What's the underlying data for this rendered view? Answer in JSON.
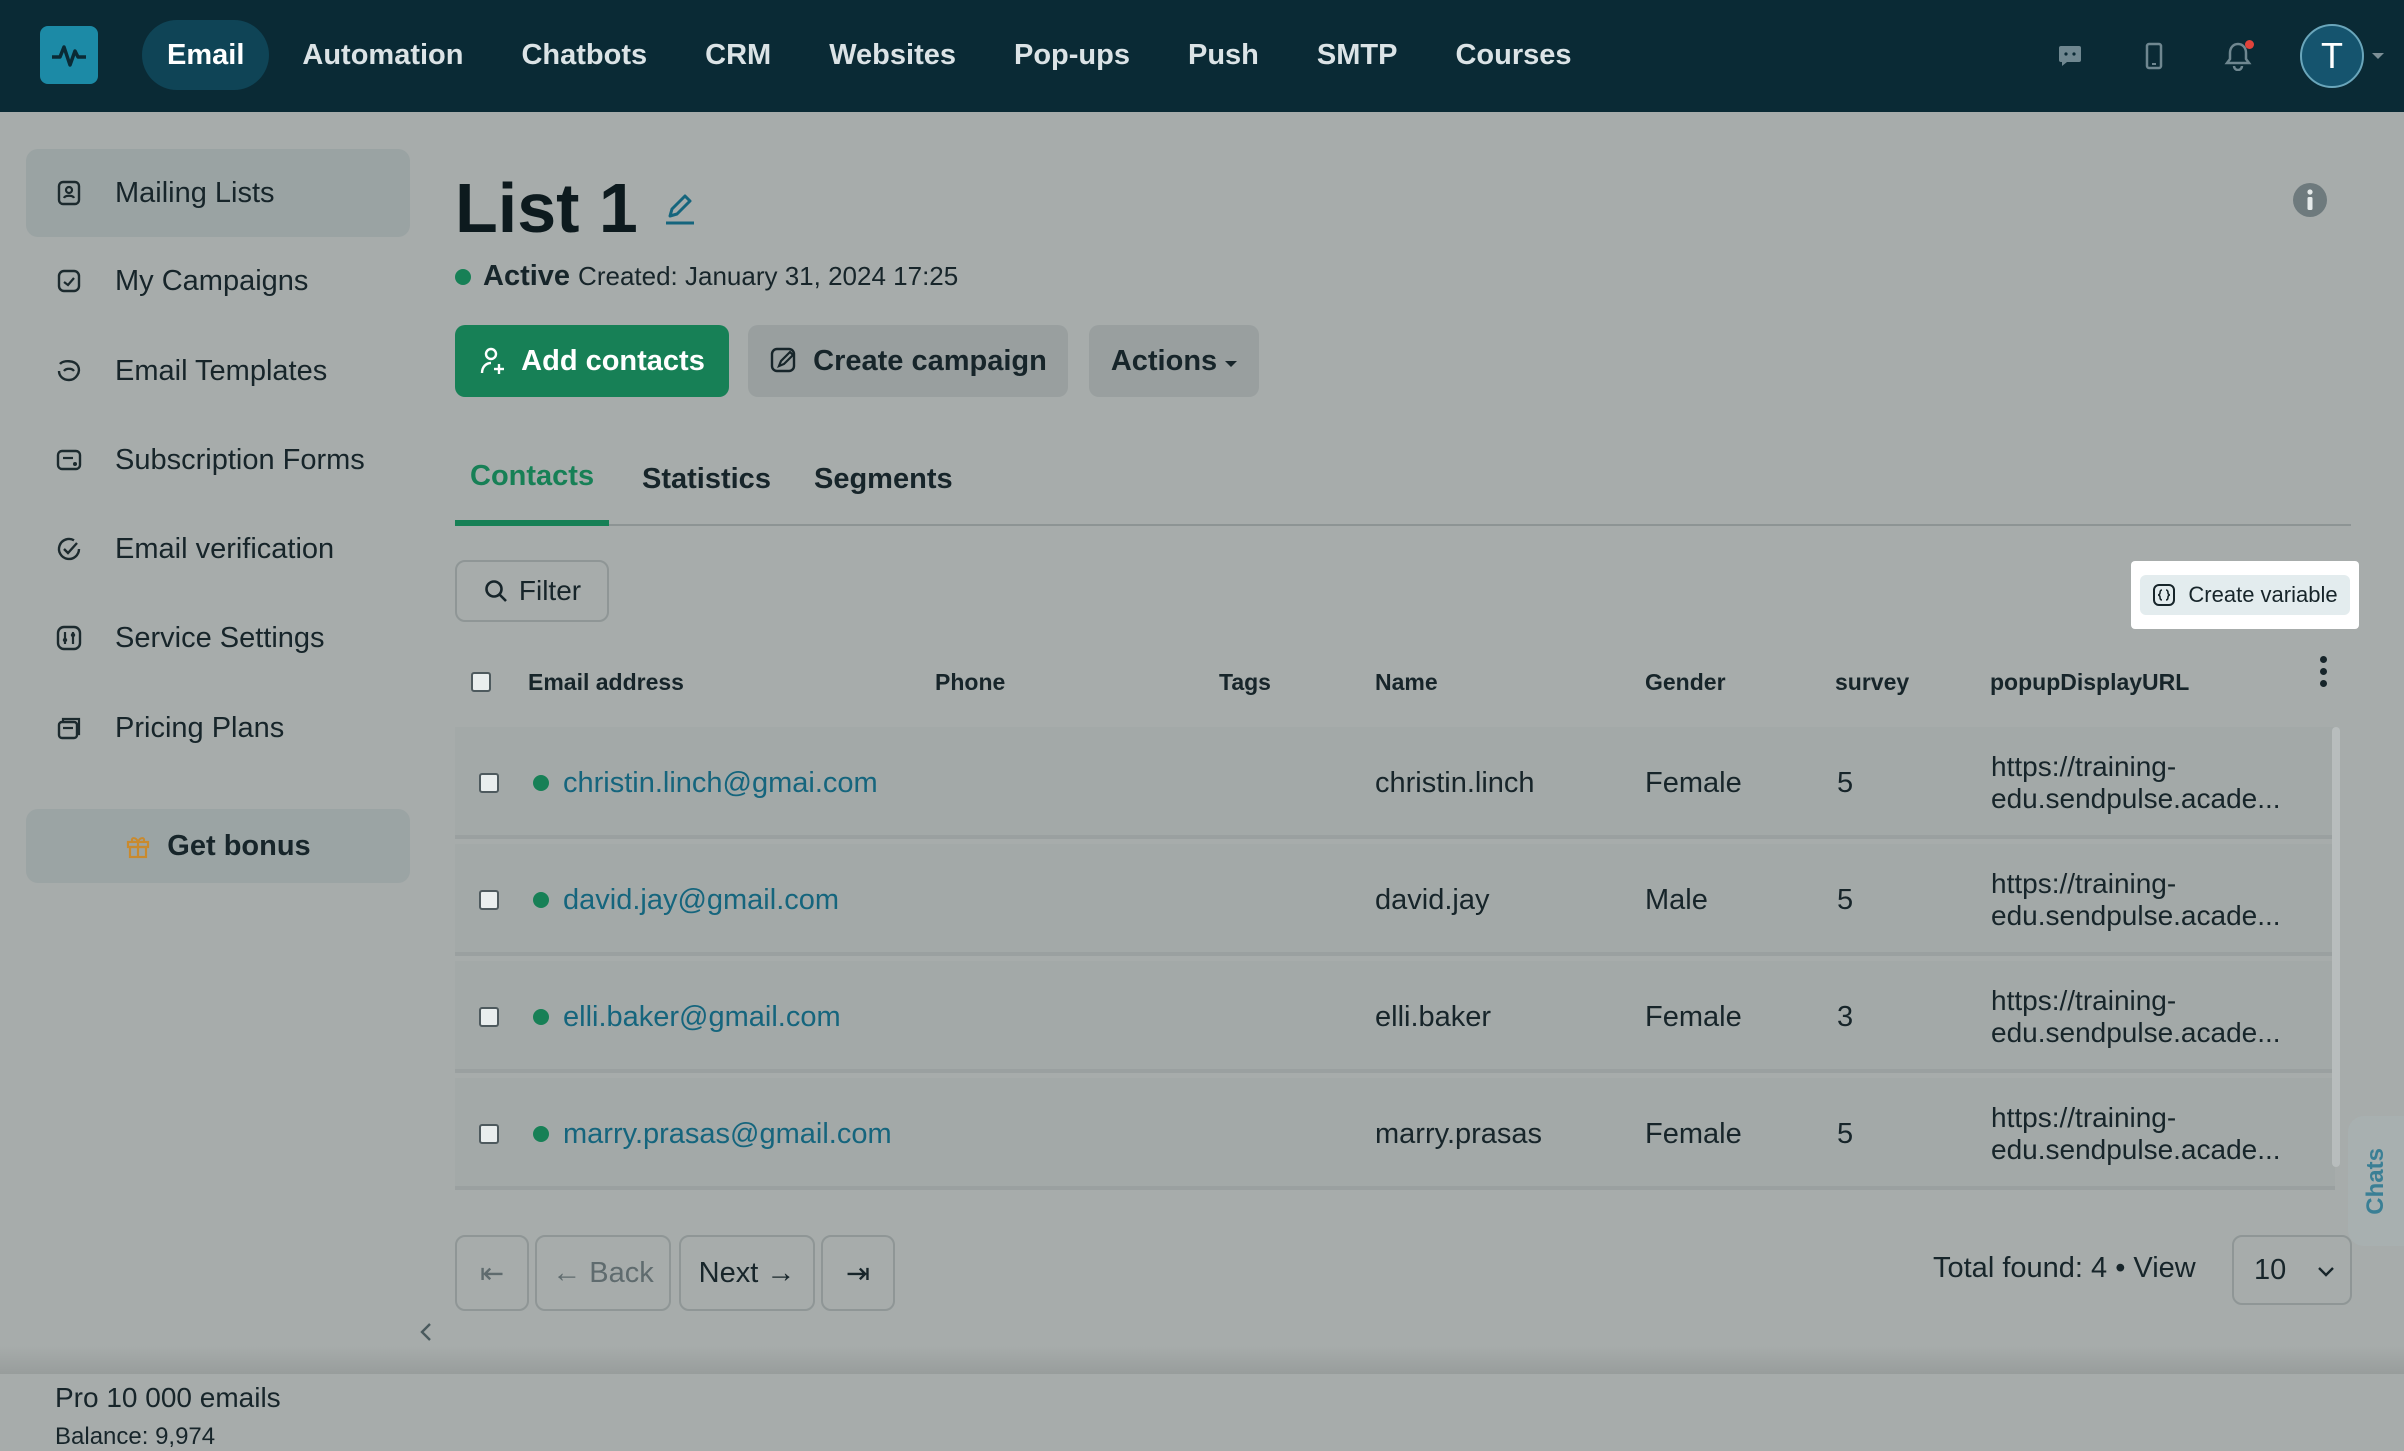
{
  "topnav": {
    "items": [
      "Email",
      "Automation",
      "Chatbots",
      "CRM",
      "Websites",
      "Pop-ups",
      "Push",
      "SMTP",
      "Courses"
    ],
    "active": "Email",
    "avatar_letter": "T",
    "icons": [
      "chat-icon",
      "mobile-icon",
      "bell-icon"
    ]
  },
  "sidebar": {
    "items": [
      {
        "label": "Mailing Lists",
        "icon": "contacts-icon",
        "active": true
      },
      {
        "label": "My Campaigns",
        "icon": "campaign-icon",
        "active": false
      },
      {
        "label": "Email Templates",
        "icon": "template-icon",
        "active": false
      },
      {
        "label": "Subscription Forms",
        "icon": "form-icon",
        "active": false
      },
      {
        "label": "Email verification",
        "icon": "check-badge-icon",
        "active": false
      },
      {
        "label": "Service Settings",
        "icon": "settings-icon",
        "active": false
      },
      {
        "label": "Pricing Plans",
        "icon": "pricing-icon",
        "active": false
      }
    ],
    "bonus_label": "Get bonus",
    "plan": "Pro 10 000 emails",
    "balance": "Balance: 9,974"
  },
  "list": {
    "title": "List 1",
    "status": "Active",
    "created": "Created: January 31, 2024 17:25"
  },
  "buttons": {
    "add_contacts": "Add contacts",
    "create_campaign": "Create campaign",
    "actions": "Actions"
  },
  "tabs": [
    "Contacts",
    "Statistics",
    "Segments"
  ],
  "active_tab": "Contacts",
  "filter_label": "Filter",
  "create_variable_label": "Create variable",
  "table": {
    "columns": [
      "Email address",
      "Phone",
      "Tags",
      "Name",
      "Gender",
      "survey",
      "popupDisplayURL"
    ],
    "rows": [
      {
        "email": "christin.linch@gmai.com",
        "phone": "",
        "tags": "",
        "name": "christin.linch",
        "gender": "Female",
        "survey": "5",
        "url": "https://training-edu.sendpulse.acade..."
      },
      {
        "email": "david.jay@gmail.com",
        "phone": "",
        "tags": "",
        "name": "david.jay",
        "gender": "Male",
        "survey": "5",
        "url": "https://training-edu.sendpulse.acade..."
      },
      {
        "email": "elli.baker@gmail.com",
        "phone": "",
        "tags": "",
        "name": "elli.baker",
        "gender": "Female",
        "survey": "3",
        "url": "https://training-edu.sendpulse.acade..."
      },
      {
        "email": "marry.prasas@gmail.com",
        "phone": "",
        "tags": "",
        "name": "marry.prasas",
        "gender": "Female",
        "survey": "5",
        "url": "https://training-edu.sendpulse.acade..."
      }
    ]
  },
  "pagination": {
    "first": "⇤",
    "back": "← Back",
    "next": "Next →",
    "last": "⇥",
    "total": "Total found: 4",
    "view_label": "View",
    "view_value": "10"
  },
  "chats_label": "Chats",
  "colors": {
    "accent": "#178056",
    "topbar": "#0a2a35",
    "link": "#15657d"
  }
}
